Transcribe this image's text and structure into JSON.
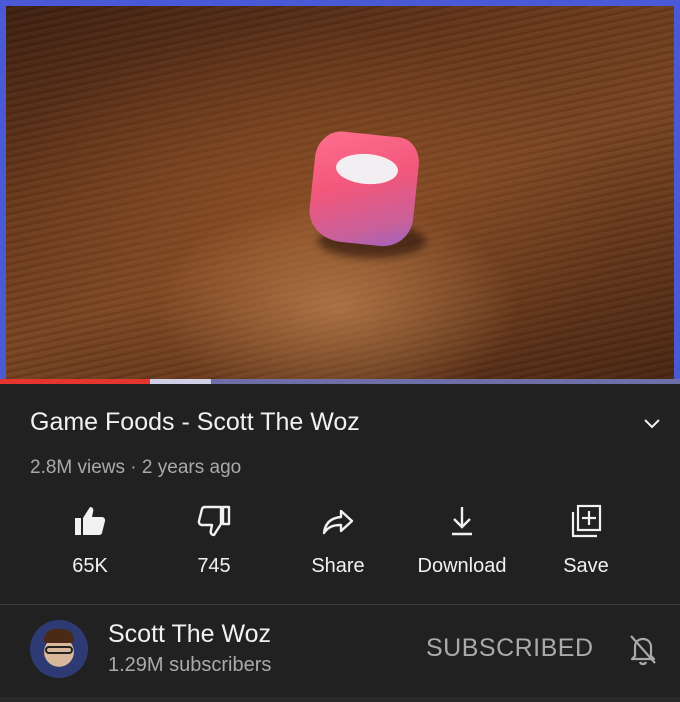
{
  "video": {
    "progress_played_fraction": 0.22
  },
  "details": {
    "title": "Game Foods - Scott The Woz",
    "meta": "2.8M views · 2 years ago"
  },
  "actions": [
    {
      "label": "65K",
      "icon": "thumbs-up-icon"
    },
    {
      "label": "745",
      "icon": "thumbs-down-icon"
    },
    {
      "label": "Share",
      "icon": "share-icon"
    },
    {
      "label": "Download",
      "icon": "download-icon"
    },
    {
      "label": "Save",
      "icon": "save-to-playlist-icon"
    }
  ],
  "channel": {
    "name": "Scott The Woz",
    "subscribers": "1.29M subscribers",
    "subscribe_state": "SUBSCRIBED"
  },
  "colors": {
    "background": "#212121",
    "progress_played": "#e5352e",
    "frame_border": "#4a5ad6"
  }
}
